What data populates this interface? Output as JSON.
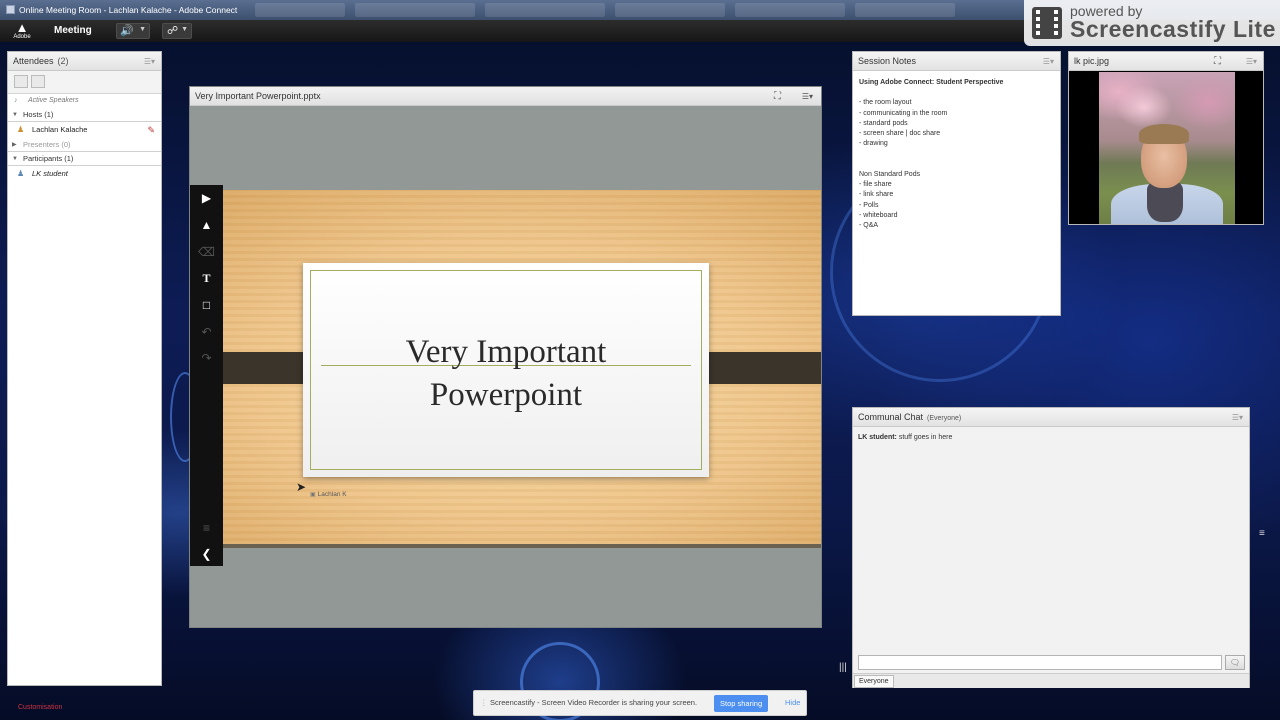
{
  "window": {
    "title": "Online Meeting Room - Lachlan Kalache - Adobe Connect"
  },
  "menubar": {
    "logo_text": "Adobe",
    "menu_label": "Meeting"
  },
  "watermark": {
    "powered": "powered by",
    "brand": "Screencastify Lite"
  },
  "attendees": {
    "title": "Attendees",
    "count": "(2)",
    "active_speakers": "Active Speakers",
    "hosts_label": "Hosts (1)",
    "host_name": "Lachlan Kalache",
    "presenters_label": "Presenters (0)",
    "participants_label": "Participants (1)",
    "participant_name": "LK student"
  },
  "share": {
    "title": "Very Important Powerpoint.pptx",
    "slide_title_line1": "Very Important",
    "slide_title_line2": "Powerpoint",
    "cursor_label": "Lachlan K"
  },
  "notes": {
    "title": "Session Notes",
    "heading": "Using Adobe Connect: Student Perspective",
    "standard_items": [
      "- the room layout",
      "- communicating in the room",
      "- standard pods",
      "- screen share | doc share",
      "- drawing"
    ],
    "nonstandard_heading": "Non Standard Pods",
    "nonstandard_items": [
      "- file share",
      "- link share",
      "- Polls",
      "- whiteboard",
      "- Q&A"
    ]
  },
  "camera": {
    "title": "lk pic.jpg"
  },
  "chat": {
    "title": "Communal Chat",
    "scope": "(Everyone)",
    "message_sender": "LK student:",
    "message_text": " stuff goes in here",
    "input_value": "",
    "tab_label": "Everyone"
  },
  "sharebar": {
    "message": "Screencastify - Screen Video Recorder is sharing your screen.",
    "stop_label": "Stop sharing",
    "hide_label": "Hide"
  },
  "bottom_left_fragment": "Customisation",
  "icons": {
    "adobe": "adobe-logo-icon",
    "speaker": "speaker-icon",
    "camera": "webcam-icon",
    "pointer": "pointer-tool-icon",
    "pencil": "pencil-tool-icon",
    "trash": "trash-icon",
    "text": "text-tool-icon",
    "shape": "rectangle-tool-icon",
    "undo": "undo-icon",
    "redo": "redo-icon",
    "layers": "layers-icon",
    "collapse": "chevron-left-icon",
    "fullscreen": "fullscreen-icon",
    "menu": "pod-menu-icon",
    "send": "send-chat-icon"
  },
  "colors": {
    "accent_blue": "#4c8ff0",
    "audio_green": "#5cd65c",
    "slide_border": "#a4ad5e"
  }
}
